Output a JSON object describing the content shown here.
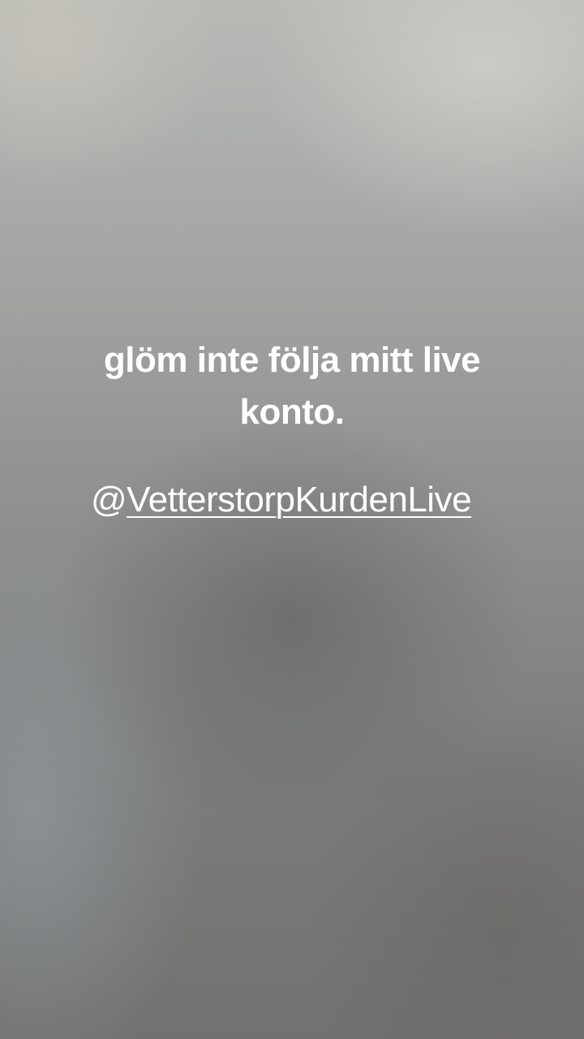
{
  "story": {
    "caption": "glöm inte följa mitt live konto.",
    "mention_prefix": "@",
    "mention_handle": "VetterstorpKurdenLive"
  }
}
